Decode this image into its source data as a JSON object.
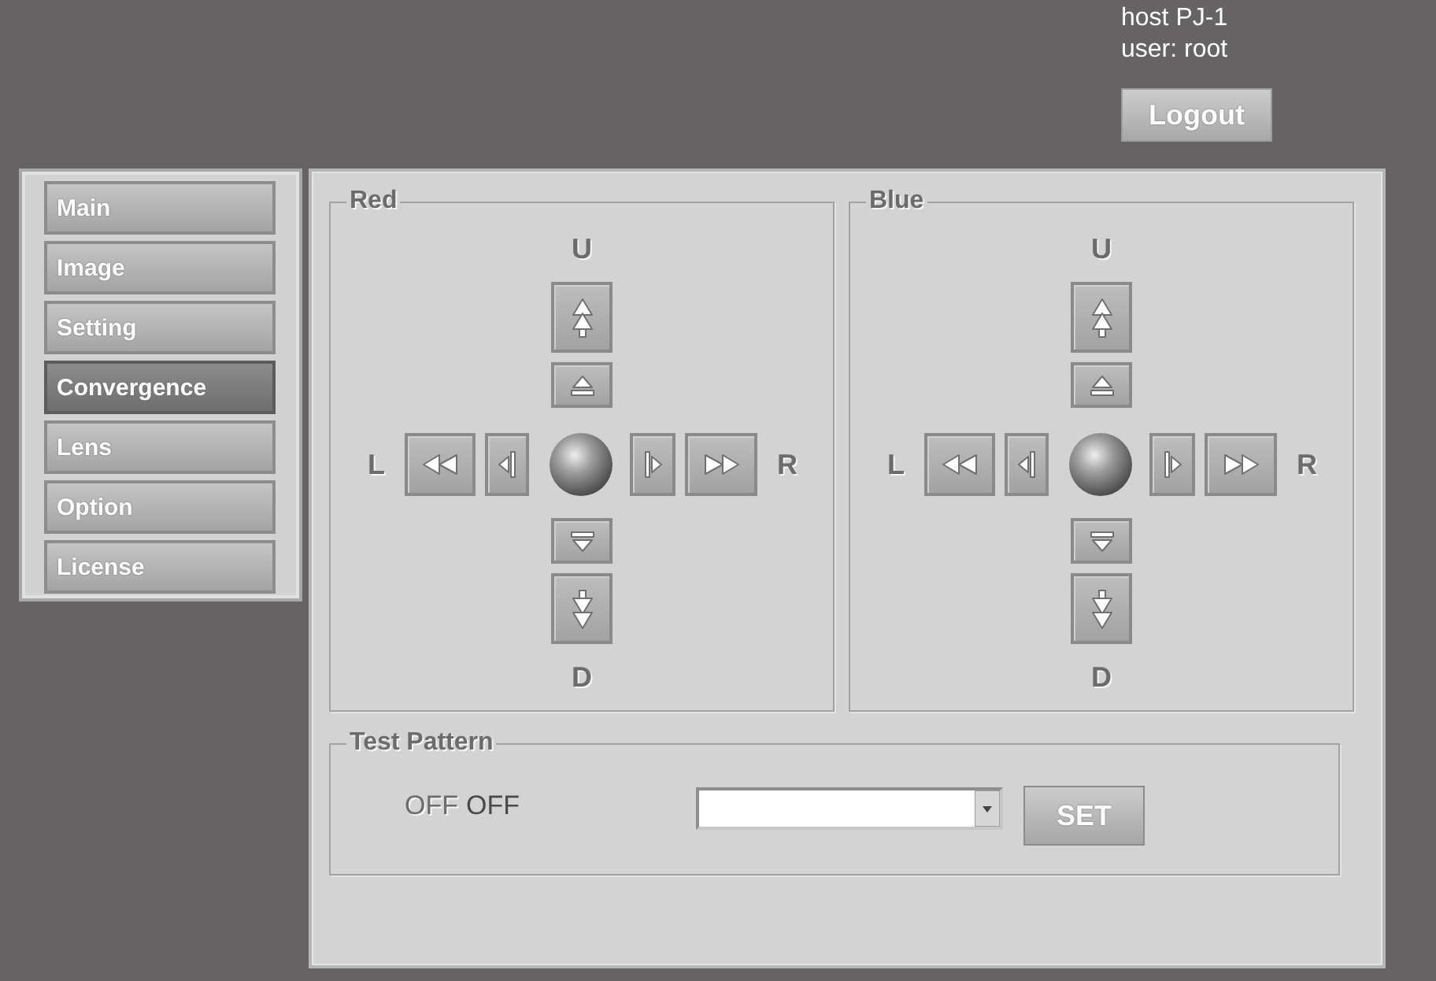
{
  "header": {
    "host": "host PJ-1",
    "user": "user: root",
    "logout_button": "Logout"
  },
  "sidebar": {
    "items": [
      {
        "label": "Main",
        "selected": false
      },
      {
        "label": "Image",
        "selected": false
      },
      {
        "label": "Setting",
        "selected": false
      },
      {
        "label": "Convergence",
        "selected": true
      },
      {
        "label": "Lens",
        "selected": false
      },
      {
        "label": "Option",
        "selected": false
      },
      {
        "label": "License",
        "selected": false
      }
    ]
  },
  "panels": [
    {
      "title": "Red",
      "up_label": "U",
      "left_label": "L",
      "right_label": "R",
      "down_label": "D"
    },
    {
      "title": "Blue",
      "up_label": "U",
      "left_label": "L",
      "right_label": "R",
      "down_label": "D"
    }
  ],
  "test_pattern": {
    "title": "Test Pattern",
    "label": "OFF",
    "value": "OFF",
    "set_button": "SET"
  }
}
